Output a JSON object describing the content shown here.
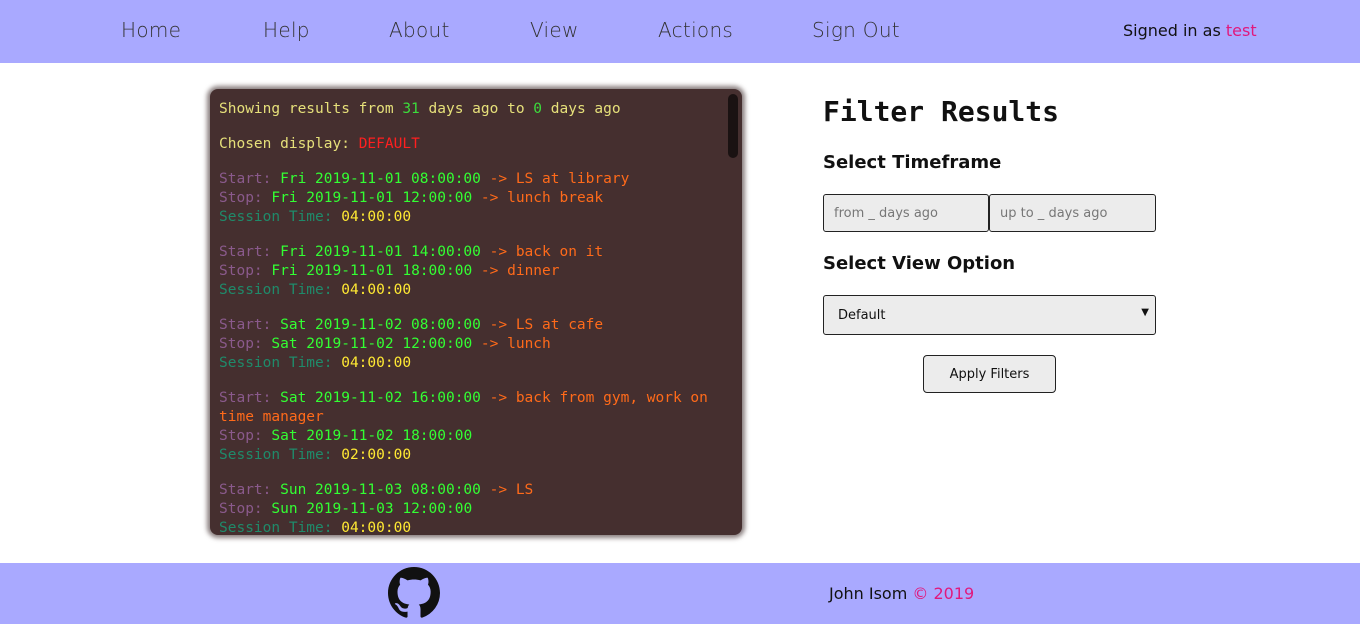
{
  "nav": {
    "links": [
      "Home",
      "Help",
      "About",
      "View",
      "Actions",
      "Sign Out"
    ],
    "signed_in_prefix": "Signed in as ",
    "username": "test"
  },
  "terminal": {
    "header": {
      "prefix": "Showing results from ",
      "from_days": "31",
      "mid": " days ago to ",
      "to_days": "0",
      "suffix": " days ago"
    },
    "display": {
      "label": "Chosen display: ",
      "value": "DEFAULT"
    },
    "labels": {
      "start": "Start: ",
      "stop": "Stop: ",
      "session": "Session Time: ",
      "arrow": " -> "
    },
    "sessions": [
      {
        "start": "Fri 2019-11-01 08:00:00",
        "start_note": "LS at library",
        "stop": "Fri 2019-11-01 12:00:00",
        "stop_note": "lunch break",
        "time": "04:00:00"
      },
      {
        "start": "Fri 2019-11-01 14:00:00",
        "start_note": "back on it",
        "stop": "Fri 2019-11-01 18:00:00",
        "stop_note": "dinner",
        "time": "04:00:00"
      },
      {
        "start": "Sat 2019-11-02 08:00:00",
        "start_note": "LS at cafe",
        "stop": "Sat 2019-11-02 12:00:00",
        "stop_note": "lunch",
        "time": "04:00:00"
      },
      {
        "start": "Sat 2019-11-02 16:00:00",
        "start_note": "back from gym, work on time manager",
        "stop": "Sat 2019-11-02 18:00:00",
        "stop_note": "",
        "time": "02:00:00"
      },
      {
        "start": "Sun 2019-11-03 08:00:00",
        "start_note": "LS",
        "stop": "Sun 2019-11-03 12:00:00",
        "stop_note": "",
        "time": "04:00:00"
      }
    ]
  },
  "filter": {
    "title": "Filter Results",
    "timeframe_title": "Select Timeframe",
    "from_placeholder": "from _ days ago",
    "to_placeholder": "up to _ days ago",
    "view_title": "Select View Option",
    "view_selected": "Default",
    "apply_label": "Apply Filters"
  },
  "footer": {
    "author": "John Isom ",
    "copyright": "© 2019",
    "github_icon": "github-icon"
  },
  "colors": {
    "bar": "#a9a9ff",
    "terminal_bg": "#452f2f",
    "accent_pink": "#e0197d"
  }
}
